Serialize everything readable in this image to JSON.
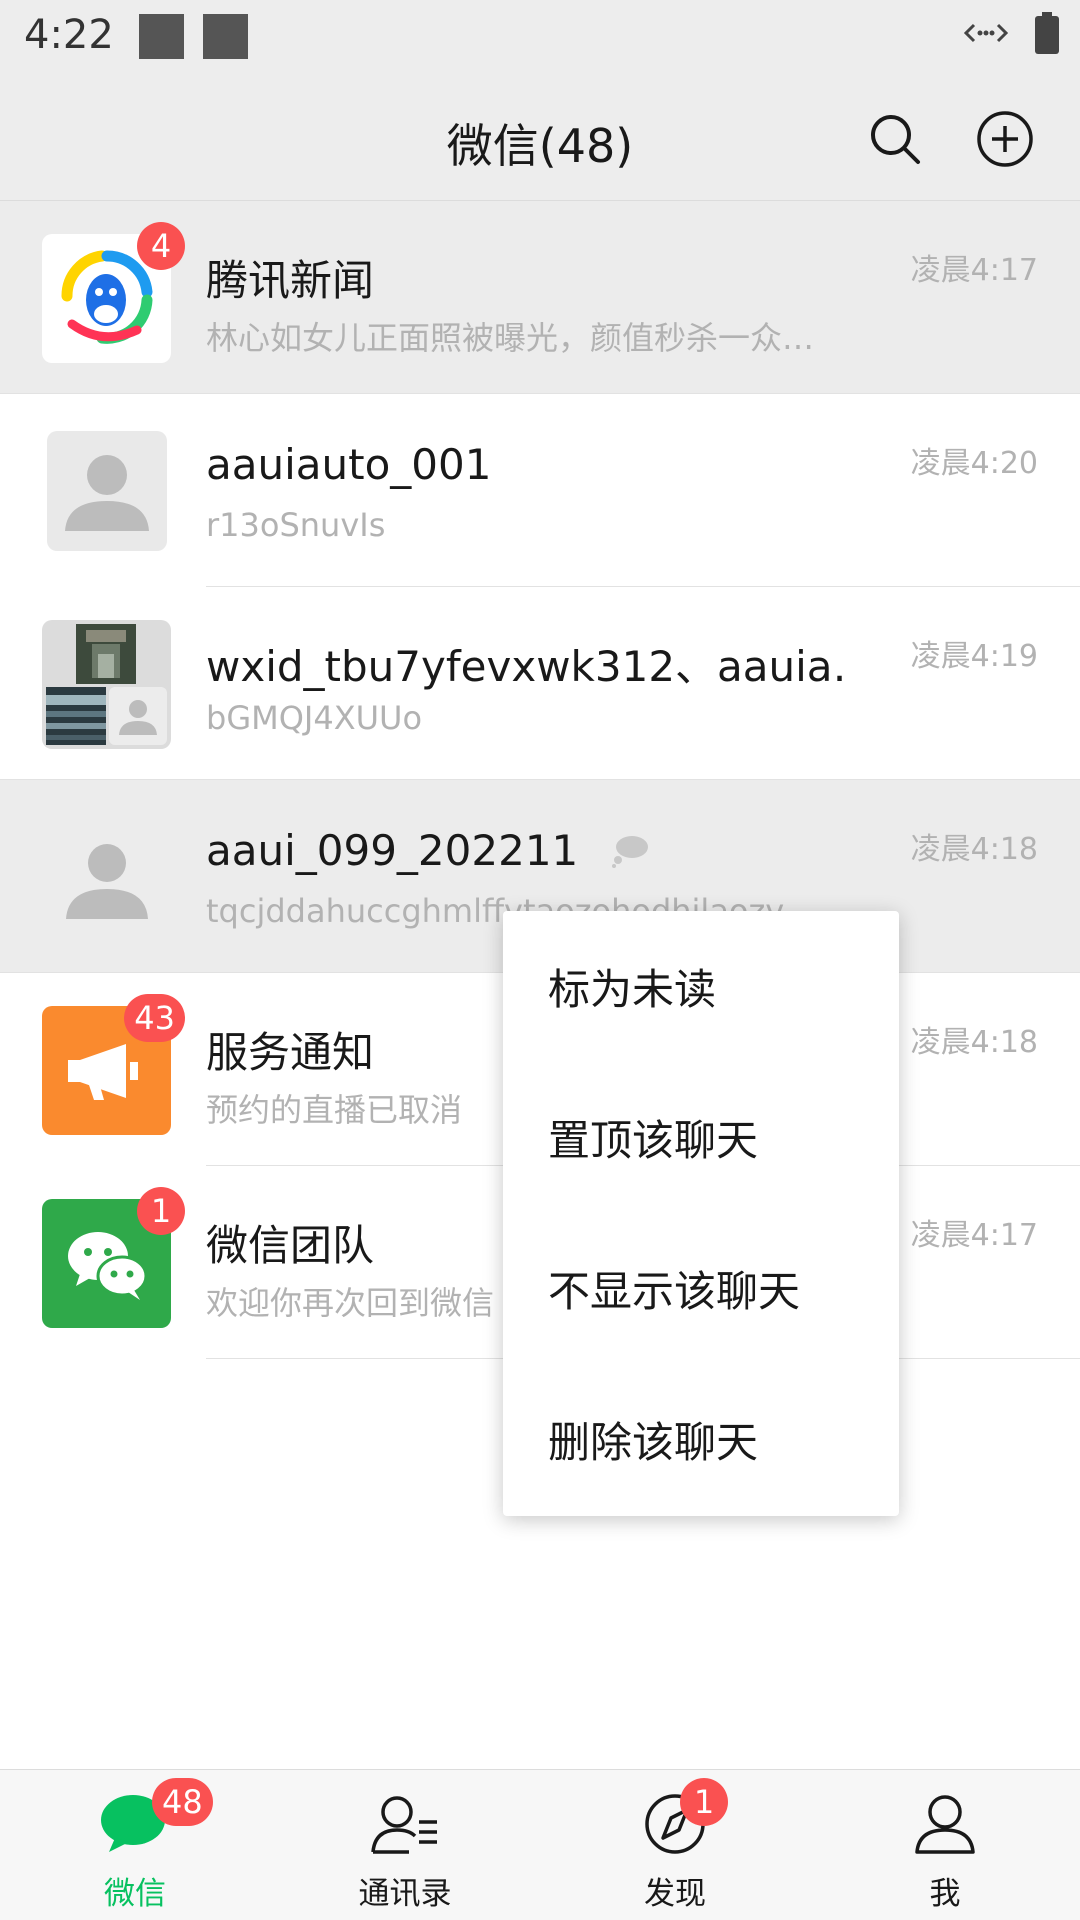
{
  "status_bar": {
    "time": "4:22"
  },
  "header": {
    "title": "微信(48)"
  },
  "chats": [
    {
      "name": "腾讯新闻",
      "message": "林心如女儿正面照被曝光，颜值秒杀一众…",
      "time": "凌晨4:17",
      "badge": "4"
    },
    {
      "name": "aauiauto_001",
      "message": "r13oSnuvIs",
      "time": "凌晨4:20"
    },
    {
      "name": "wxid_tbu7yfevxwk312、aauia…",
      "message": "bGMQJ4XUUo",
      "time": "凌晨4:19"
    },
    {
      "name": "aaui_099_202211",
      "message": "tqcjddahuccghmlffvtaozohodhilaozv",
      "time": "凌晨4:18"
    },
    {
      "name": "服务通知",
      "message": "预约的直播已取消",
      "time": "凌晨4:18",
      "badge": "43"
    },
    {
      "name": "微信团队",
      "message": "欢迎你再次回到微信",
      "time": "凌晨4:17",
      "badge": "1"
    }
  ],
  "context_menu": {
    "items": [
      "标为未读",
      "置顶该聊天",
      "不显示该聊天",
      "删除该聊天"
    ]
  },
  "tabs": [
    {
      "label": "微信",
      "badge": "48"
    },
    {
      "label": "通讯录"
    },
    {
      "label": "发现",
      "badge": "1"
    },
    {
      "label": "我"
    }
  ],
  "colors": {
    "accent": "#07c160",
    "badge": "#fa5151",
    "header_bg": "#ededed",
    "highlight_row": "#ececec",
    "news_orange": "#fa8a2e",
    "team_green": "#2fa94a"
  }
}
